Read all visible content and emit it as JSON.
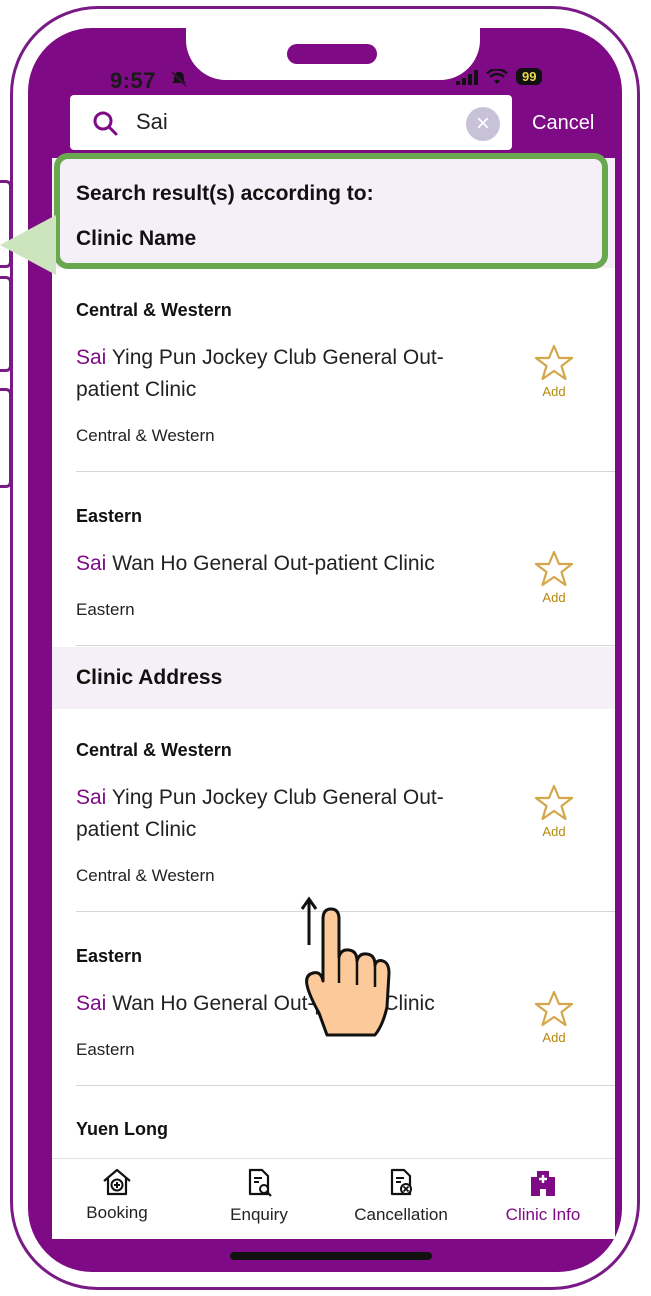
{
  "status_bar": {
    "time": "9:57",
    "battery": "99"
  },
  "search": {
    "value": "Sai",
    "cancel_label": "Cancel"
  },
  "result_header": {
    "line1": "Search result(s) according to:",
    "line2": "Clinic Name"
  },
  "clinic_name_results": [
    {
      "district": "Central & Western",
      "name_highlight": "Sai",
      "name_rest": " Ying Pun Jockey Club General Out-patient Clinic",
      "sub_district": "Central & Western",
      "fav_label": "Add"
    },
    {
      "district": "Eastern",
      "name_highlight": "Sai",
      "name_rest": " Wan Ho General Out-patient Clinic",
      "sub_district": "Eastern",
      "fav_label": "Add"
    }
  ],
  "address_section": {
    "title": "Clinic Address"
  },
  "clinic_address_results": [
    {
      "district": "Central & Western",
      "name_highlight": "Sai",
      "name_rest": " Ying Pun Jockey Club General Out-patient Clinic",
      "sub_district": "Central & Western",
      "fav_label": "Add"
    },
    {
      "district": "Eastern",
      "name_highlight": "Sai",
      "name_rest": " Wan Ho General Out-patient Clinic",
      "sub_district": "Eastern",
      "fav_label": "Add"
    },
    {
      "district": "Yuen Long"
    }
  ],
  "tabs": [
    {
      "label": "Booking",
      "icon": "home-plus-icon",
      "active": false
    },
    {
      "label": "Enquiry",
      "icon": "document-search-icon",
      "active": false
    },
    {
      "label": "Cancellation",
      "icon": "document-cancel-icon",
      "active": false
    },
    {
      "label": "Clinic Info",
      "icon": "hospital-icon",
      "active": true
    }
  ],
  "colors": {
    "brand": "#7e0a86",
    "highlight_border": "#6aa84f",
    "star": "#d4a84a",
    "section_bg": "#f5eff7"
  }
}
